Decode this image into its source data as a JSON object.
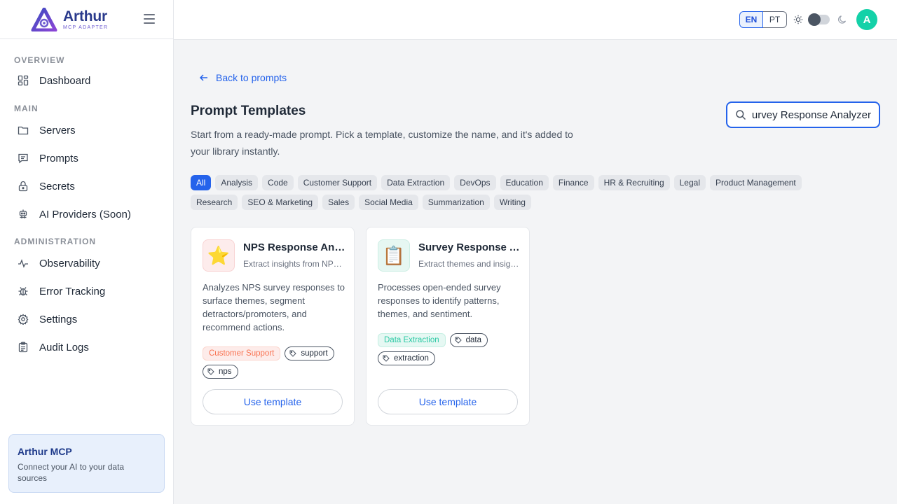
{
  "brand": {
    "name": "Arthur",
    "subtitle": "MCP ADAPTER"
  },
  "sidebar": {
    "sections": [
      {
        "title": "OVERVIEW",
        "items": [
          {
            "label": "Dashboard",
            "icon": "dashboard-icon"
          }
        ]
      },
      {
        "title": "MAIN",
        "items": [
          {
            "label": "Servers",
            "icon": "folder-icon"
          },
          {
            "label": "Prompts",
            "icon": "message-icon"
          },
          {
            "label": "Secrets",
            "icon": "lock-icon"
          },
          {
            "label": "AI Providers (Soon)",
            "icon": "bot-icon"
          }
        ]
      },
      {
        "title": "ADMINISTRATION",
        "items": [
          {
            "label": "Observability",
            "icon": "activity-icon"
          },
          {
            "label": "Error Tracking",
            "icon": "bug-icon"
          },
          {
            "label": "Settings",
            "icon": "gear-icon"
          },
          {
            "label": "Audit Logs",
            "icon": "clipboard-icon"
          }
        ]
      }
    ],
    "promo": {
      "title": "Arthur MCP",
      "text": "Connect your AI to your data sources"
    }
  },
  "topbar": {
    "languages": [
      "EN",
      "PT"
    ],
    "selected_language": "EN",
    "theme": "light",
    "avatar_initial": "A"
  },
  "main": {
    "back_label": "Back to prompts",
    "title": "Prompt Templates",
    "description": "Start from a ready-made prompt. Pick a template, customize the name, and it's added to your library instantly.",
    "search_value": "Survey Response Analyzer",
    "filters": [
      "All",
      "Analysis",
      "Code",
      "Customer Support",
      "Data Extraction",
      "DevOps",
      "Education",
      "Finance",
      "HR & Recruiting",
      "Legal",
      "Product Management",
      "Research",
      "SEO & Marketing",
      "Sales",
      "Social Media",
      "Summarization",
      "Writing"
    ],
    "active_filter": "All",
    "cards": [
      {
        "emoji": "⭐",
        "title": "NPS Response Analyzer",
        "subtitle": "Extract insights from NPS survey responses",
        "description": "Analyzes NPS survey responses to surface themes, segment detractors/promoters, and recommend actions.",
        "category": "Customer Support",
        "category_color": "#f97352",
        "category_bg": "#fdecea",
        "thumb_bg": "#fdecec",
        "tags": [
          "support",
          "nps"
        ],
        "button": "Use template"
      },
      {
        "emoji": "📋",
        "title": "Survey Response Analyzer",
        "subtitle": "Extract themes and insights from surveys",
        "description": "Processes open-ended survey responses to identify patterns, themes, and sentiment.",
        "category": "Data Extraction",
        "category_color": "#2bc9a4",
        "category_bg": "#e6f8f3",
        "thumb_bg": "#e6f7f2",
        "tags": [
          "data",
          "extraction"
        ],
        "button": "Use template"
      }
    ]
  },
  "colors": {
    "accent": "#2563eb",
    "avatar": "#14d1a8",
    "brand": "#2a3a8c"
  }
}
